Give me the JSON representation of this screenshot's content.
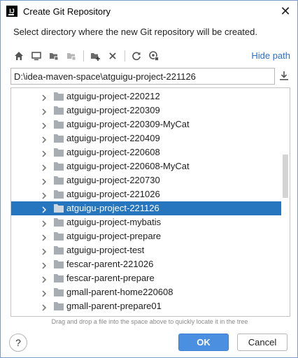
{
  "window": {
    "title": "Create Git Repository",
    "close_glyph": "✕"
  },
  "description": "Select directory where the new Git repository will be created.",
  "toolbar": {
    "buttons": [
      "home-icon",
      "desktop-icon",
      "project-folder-icon",
      "module-folder-icon",
      "new-folder-icon",
      "delete-icon",
      "refresh-icon",
      "show-hidden-icon"
    ],
    "hide_path": "Hide path"
  },
  "path": {
    "value": "D:\\idea-maven-space\\atguigu-project-221126"
  },
  "tree": {
    "items": [
      {
        "label": "atguigu-project-220212",
        "selected": false
      },
      {
        "label": "atguigu-project-220309",
        "selected": false
      },
      {
        "label": "atguigu-project-220309-MyCat",
        "selected": false
      },
      {
        "label": "atguigu-project-220409",
        "selected": false
      },
      {
        "label": "atguigu-project-220608",
        "selected": false
      },
      {
        "label": "atguigu-project-220608-MyCat",
        "selected": false
      },
      {
        "label": "atguigu-project-220730",
        "selected": false
      },
      {
        "label": "atguigu-project-221026",
        "selected": false
      },
      {
        "label": "atguigu-project-221126",
        "selected": true
      },
      {
        "label": "atguigu-project-mybatis",
        "selected": false
      },
      {
        "label": "atguigu-project-prepare",
        "selected": false
      },
      {
        "label": "atguigu-project-test",
        "selected": false
      },
      {
        "label": "fescar-parent-221026",
        "selected": false
      },
      {
        "label": "fescar-parent-prepare",
        "selected": false
      },
      {
        "label": "gmall-parent-home220608",
        "selected": false
      },
      {
        "label": "gmall-parent-prepare01",
        "selected": false
      }
    ]
  },
  "hint": "Drag and drop a file into the space above to quickly locate it in the tree",
  "buttons": {
    "help": "?",
    "ok": "OK",
    "cancel": "Cancel"
  },
  "colors": {
    "selection": "#2675bf",
    "link": "#2a6ecf",
    "ok": "#4a8fe0",
    "folder": "#a8adb3"
  }
}
